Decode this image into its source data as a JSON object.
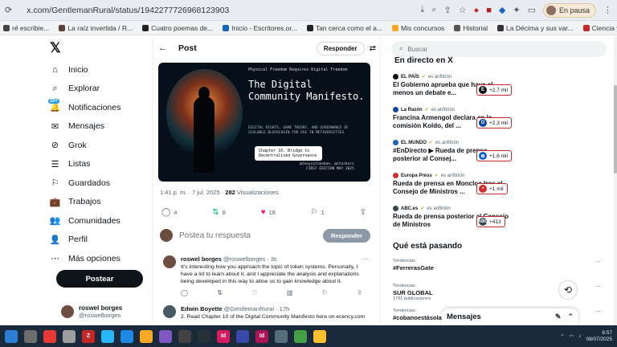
{
  "browser": {
    "url": "x.com/GentlemanRural/status/1942277726968123903",
    "pause_label": "En pausa"
  },
  "bookmarks": [
    {
      "label": "ré escribie...",
      "color": "#444"
    },
    {
      "label": "La raíz invertida / R...",
      "color": "#5d4037"
    },
    {
      "label": "Cuatro poemas de...",
      "color": "#222"
    },
    {
      "label": "Inicio - Escritores.or...",
      "color": "#1565c0"
    },
    {
      "label": "Tan cerca como el a...",
      "color": "#222"
    },
    {
      "label": "Mis concursos",
      "color": "#f9a825"
    },
    {
      "label": "Historial",
      "color": "#555"
    },
    {
      "label": "La Décima y sus var...",
      "color": "#333"
    },
    {
      "label": "Ciencia y Poesía de...",
      "color": "#c62828"
    }
  ],
  "nav": {
    "items": [
      {
        "label": "Inicio",
        "icon": "home-icon",
        "glyph": "⌂"
      },
      {
        "label": "Explorar",
        "icon": "search-icon",
        "glyph": "⌕"
      },
      {
        "label": "Notificaciones",
        "icon": "bell-icon",
        "glyph": "🔔",
        "badge": "20+"
      },
      {
        "label": "Mensajes",
        "icon": "mail-icon",
        "glyph": "✉"
      },
      {
        "label": "Grok",
        "icon": "grok-icon",
        "glyph": "⊘"
      },
      {
        "label": "Listas",
        "icon": "list-icon",
        "glyph": "☰"
      },
      {
        "label": "Guardados",
        "icon": "bookmark-icon",
        "glyph": "⚐"
      },
      {
        "label": "Trabajos",
        "icon": "briefcase-icon",
        "glyph": "💼"
      },
      {
        "label": "Comunidades",
        "icon": "people-icon",
        "glyph": "👥"
      },
      {
        "label": "Perfil",
        "icon": "user-icon",
        "glyph": "👤"
      },
      {
        "label": "Más opciones",
        "icon": "more-icon",
        "glyph": "⋯"
      }
    ],
    "post_button": "Postear",
    "account_name": "roswel borges",
    "account_handle": "@roswelborges"
  },
  "post": {
    "header": "Post",
    "reply_button": "Responder",
    "banner": {
      "top_line": "Physical Freedom Requires Digital Freedom",
      "title": "The Digital Community Manifesto.",
      "subtitle": "DIGITAL RIGHTS, GAME THEORY, AND GOVERNANCE OF SCALABLE BLOCKCHAIN FOR USE IN METAVERSITIES",
      "chip": "Chapter 10. Bridge to Decentralised Governance",
      "author": "@theycallmedan. @starkerz",
      "edition": "FIRST EDITION MAY 2025"
    },
    "time": "1:41 p. m. · 7 jul. 2025 · ",
    "views": "282",
    "views_label": " Visualizaciones",
    "stats": {
      "replies": "4",
      "reposts": "8",
      "likes": "18",
      "bookmarks": "1"
    },
    "reply_placeholder": "Postea tu respuesta",
    "reply_submit": "Responder"
  },
  "replies": [
    {
      "name": "roswel borges",
      "handle": "@roswelborges · 3s",
      "text": "It's interesting how you approach the topic of token systems. Personally, I have a lot to learn about it, and I appreciate the analysis and explanations being developed in this way to allow us to gain knowledge about it."
    },
    {
      "name": "Edwin Boyette",
      "handle": "@GentlemanRural · 17h",
      "text": "2. Read Chapter 10 of the Digital Community Manifesto here on ecency.com"
    }
  ],
  "right": {
    "search_placeholder": "Buscar",
    "live_title": "En directo en X",
    "host_suffix": "es anfitrión",
    "live": [
      {
        "host": "EL PAÍS",
        "text": "El Gobierno aprueba que haya al menos un debate e...",
        "count": "+2,7 mil",
        "icon_color": "#111",
        "icon_letter": "E"
      },
      {
        "host": "La Razón",
        "text": "Francina Armengol declara en la comisión Koldo, del ...",
        "count": "+2,3 mil",
        "icon_color": "#0d47a1",
        "icon_letter": "O"
      },
      {
        "host": "EL MUNDO",
        "text": "#EnDirecto ▶ Rueda de prensa posterior al Consej...",
        "count": "+1,6 mil",
        "icon_color": "#1565c0",
        "icon_letter": "⊕"
      },
      {
        "host": "Europa Press",
        "text": "Rueda de prensa en Moncloa tras el Consejo de Ministros ...",
        "count": "+1 mil",
        "icon_color": "#d32f2f",
        "icon_letter": "•"
      },
      {
        "host": "ABC.es",
        "text": "Rueda de prensa posterior al Consejo de Ministros",
        "count": "+413",
        "icon_color": "#37474f",
        "icon_letter": "ABC"
      }
    ],
    "trends_title": "Qué está pasando",
    "trends": [
      {
        "category": "Tendencias",
        "name": "#FerrerasGate",
        "count": ""
      },
      {
        "category": "Tendencias",
        "name": "SUR GLOBAL",
        "count": "1791 publicaciones"
      },
      {
        "category": "Tendencias",
        "name": "#cobanoestásola",
        "count": ""
      }
    ],
    "messages_label": "Mensajes"
  },
  "taskbar": {
    "time": "6:57",
    "date": "08/07/2025",
    "apps": [
      {
        "name": "windows-icon",
        "color": "#2e7dd7",
        "label": ""
      },
      {
        "name": "files-icon",
        "color": "#6d6d6d",
        "label": ""
      },
      {
        "name": "chrome-icon",
        "color": "#e53935",
        "label": ""
      },
      {
        "name": "app-icon",
        "color": "#9e9e9e",
        "label": ""
      },
      {
        "name": "zotero-icon",
        "color": "#c62828",
        "label": "Z"
      },
      {
        "name": "telegram-icon",
        "color": "#29b6f6",
        "label": ""
      },
      {
        "name": "store-icon",
        "color": "#1e88e5",
        "label": ""
      },
      {
        "name": "folder-icon",
        "color": "#f9a825",
        "label": ""
      },
      {
        "name": "vs-icon",
        "color": "#7e57c2",
        "label": ""
      },
      {
        "name": "obs-icon",
        "color": "#424242",
        "label": ""
      },
      {
        "name": "steam-icon",
        "color": "#263238",
        "label": ""
      },
      {
        "name": "indesign-icon",
        "color": "#d81b60",
        "label": "Id"
      },
      {
        "name": "photos-icon",
        "color": "#3949ab",
        "label": ""
      },
      {
        "name": "indesign2-icon",
        "color": "#ad1457",
        "label": "Id"
      },
      {
        "name": "app2-icon",
        "color": "#546e7a",
        "label": ""
      },
      {
        "name": "chrome2-icon",
        "color": "#43a047",
        "label": ""
      },
      {
        "name": "archive-icon",
        "color": "#fbc02d",
        "label": ""
      }
    ]
  }
}
